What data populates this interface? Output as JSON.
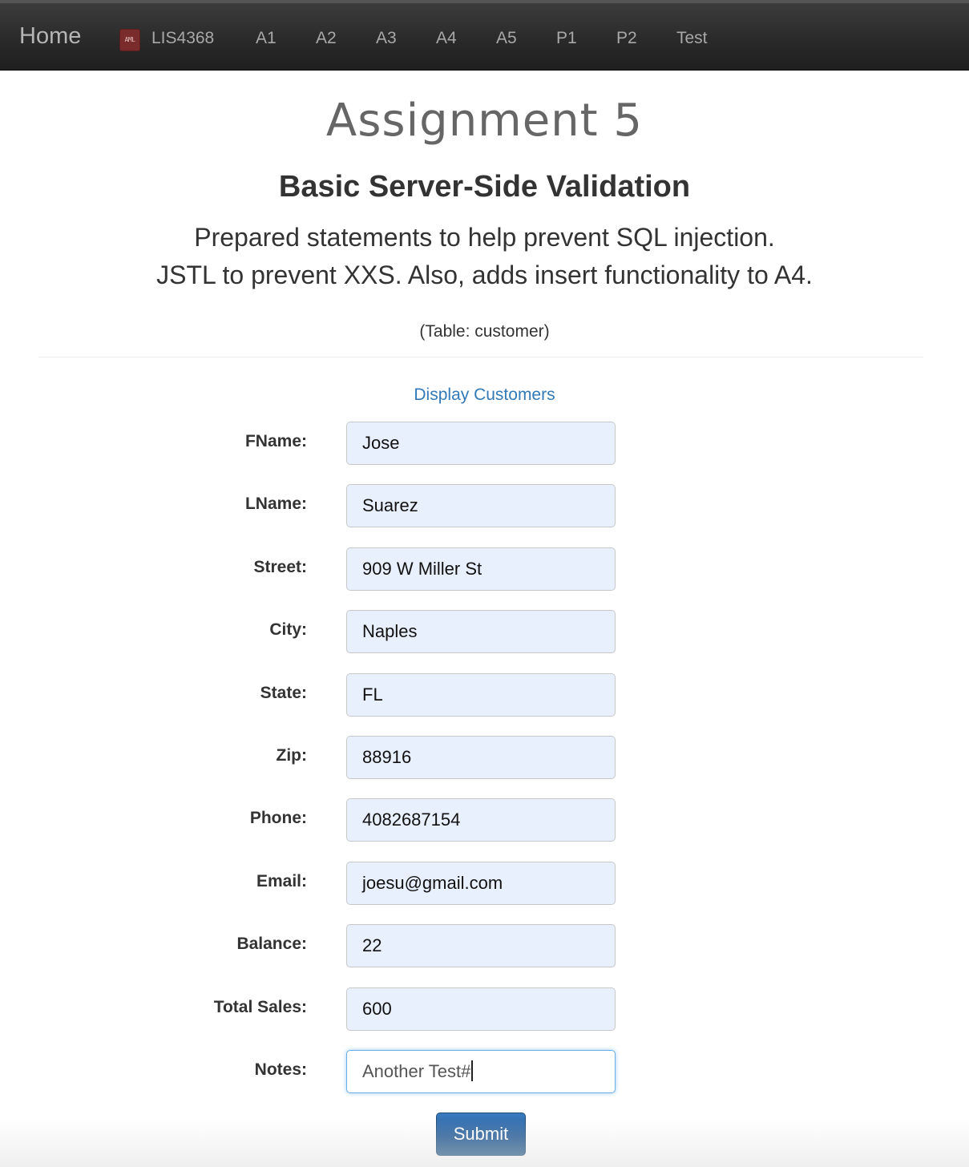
{
  "navbar": {
    "brand": "Home",
    "logo_text": "AML",
    "items": [
      {
        "label": "LIS4368"
      },
      {
        "label": "A1"
      },
      {
        "label": "A2"
      },
      {
        "label": "A3"
      },
      {
        "label": "A4"
      },
      {
        "label": "A5"
      },
      {
        "label": "P1"
      },
      {
        "label": "P2"
      },
      {
        "label": "Test"
      }
    ]
  },
  "header": {
    "title": "Assignment 5",
    "subtitle": "Basic Server-Side Validation",
    "lead_line_1": "Prepared statements to help prevent SQL injection.",
    "lead_line_2": "JSTL to prevent XXS. Also, adds insert functionality to A4.",
    "table_note": "(Table: customer)"
  },
  "display_link": "Display Customers",
  "form": {
    "fields": [
      {
        "label": "FName:",
        "value": "Jose"
      },
      {
        "label": "LName:",
        "value": "Suarez"
      },
      {
        "label": "Street:",
        "value": "909 W Miller St"
      },
      {
        "label": "City:",
        "value": "Naples"
      },
      {
        "label": "State:",
        "value": "FL"
      },
      {
        "label": "Zip:",
        "value": "88916"
      },
      {
        "label": "Phone:",
        "value": "4082687154"
      },
      {
        "label": "Email:",
        "value": "joesu@gmail.com"
      },
      {
        "label": "Balance:",
        "value": "22"
      },
      {
        "label": "Total Sales:",
        "value": "600"
      },
      {
        "label": "Notes:",
        "value": "Another Test#"
      }
    ],
    "submit_label": "Submit"
  },
  "colors": {
    "navbar_bg": "#2a2a2a",
    "link": "#337ab7",
    "autofill_bg": "#e8f0fe",
    "button_bg": "#2b5f99"
  }
}
